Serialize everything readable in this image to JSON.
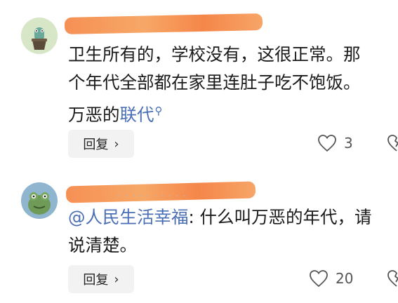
{
  "comments": [
    {
      "text_lines": [
        "卫生所有的，学校没有，这很正常。那",
        "个年代全部都在家里连肚子吃不饱饭。"
      ],
      "text_prefix": "万恶的",
      "text_link": "联代",
      "reply_label": "回复",
      "like_count": "3"
    },
    {
      "mention": "@人民生活幸福",
      "text_line1_rest": ": 什么叫万恶的年代，请",
      "text_line2": "说清楚。",
      "reply_label": "回复",
      "like_count": "20"
    }
  ],
  "colors": {
    "link": "#4a6fb5",
    "redaction": "#f58a4b",
    "reply_bg": "#f2f2f2"
  }
}
